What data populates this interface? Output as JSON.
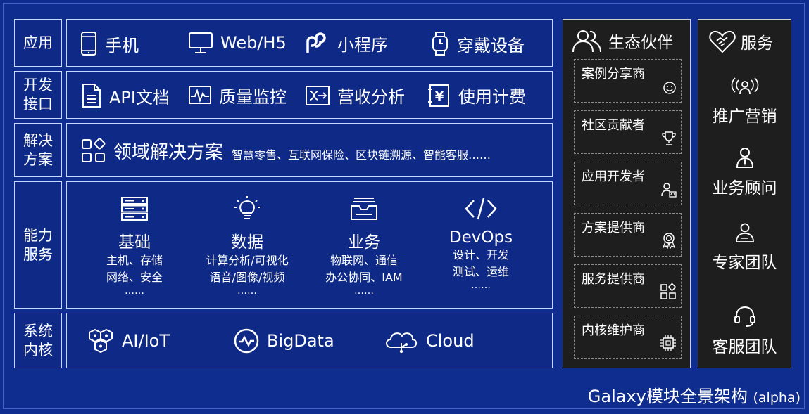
{
  "layers": {
    "app": {
      "label": "应用",
      "items": [
        {
          "label": "手机",
          "icon": "phone-icon"
        },
        {
          "label": "Web/H5",
          "icon": "monitor-icon"
        },
        {
          "label": "小程序",
          "icon": "mini-program-icon"
        },
        {
          "label": "穿戴设备",
          "icon": "watch-icon"
        }
      ]
    },
    "api": {
      "label": "开发\n接口",
      "items": [
        {
          "label": "API文档",
          "icon": "document-icon"
        },
        {
          "label": "质量监控",
          "icon": "pulse-monitor-icon"
        },
        {
          "label": "营收分析",
          "icon": "analysis-icon"
        },
        {
          "label": "使用计费",
          "icon": "billing-icon"
        }
      ]
    },
    "solution": {
      "label": "解决\n方案",
      "title": "领域解决方案",
      "icon": "apps-grid-icon",
      "examples": "智慧零售、互联网保险、区块链溯源、智能客服……"
    },
    "capability": {
      "label": "能力\n服务",
      "groups": [
        {
          "title": "基础",
          "icon": "server-icon",
          "lines": [
            "主机、存储",
            "网络、安全"
          ],
          "more": "……"
        },
        {
          "title": "数据",
          "icon": "lightbulb-icon",
          "lines": [
            "计算分析/可视化",
            "语音/图像/视频"
          ],
          "more": "……"
        },
        {
          "title": "业务",
          "icon": "inbox-tray-icon",
          "lines": [
            "物联网、通信",
            "办公协同、IAM"
          ],
          "more": "……"
        },
        {
          "title": "DevOps",
          "icon": "code-icon",
          "lines": [
            "设计、开发",
            "测试、运维"
          ],
          "more": "……"
        }
      ]
    },
    "kernel": {
      "label": "系统\n内核",
      "items": [
        {
          "label": "AI/IoT",
          "icon": "hexagon-cluster-icon"
        },
        {
          "label": "BigData",
          "icon": "wave-circle-icon"
        },
        {
          "label": "Cloud",
          "icon": "cloud-icon"
        }
      ]
    }
  },
  "partners": {
    "title": "生态伙伴",
    "icon": "people-icon",
    "items": [
      {
        "label": "案例分享商",
        "icon": "smile-icon"
      },
      {
        "label": "社区贡献者",
        "icon": "trophy-icon"
      },
      {
        "label": "应用开发者",
        "icon": "developer-icon"
      },
      {
        "label": "方案提供商",
        "icon": "award-icon"
      },
      {
        "label": "服务提供商",
        "icon": "blocks-icon"
      },
      {
        "label": "内核维护商",
        "icon": "chip-icon"
      }
    ]
  },
  "services": {
    "title": "服务",
    "icon": "handshake-heart-icon",
    "items": [
      {
        "label": "推广营销",
        "icon": "broadcast-person-icon"
      },
      {
        "label": "业务顾问",
        "icon": "advisor-icon"
      },
      {
        "label": "专家团队",
        "icon": "expert-icon"
      },
      {
        "label": "客服团队",
        "icon": "headset-icon"
      }
    ]
  },
  "footer": {
    "title": "Galaxy模块全景架构",
    "tag": "(alpha)"
  },
  "colors": {
    "background": "#0f2d8f",
    "panel": "#0e2a86",
    "border": "#c9d6ff",
    "dark_panel": "#1e1e1e"
  }
}
